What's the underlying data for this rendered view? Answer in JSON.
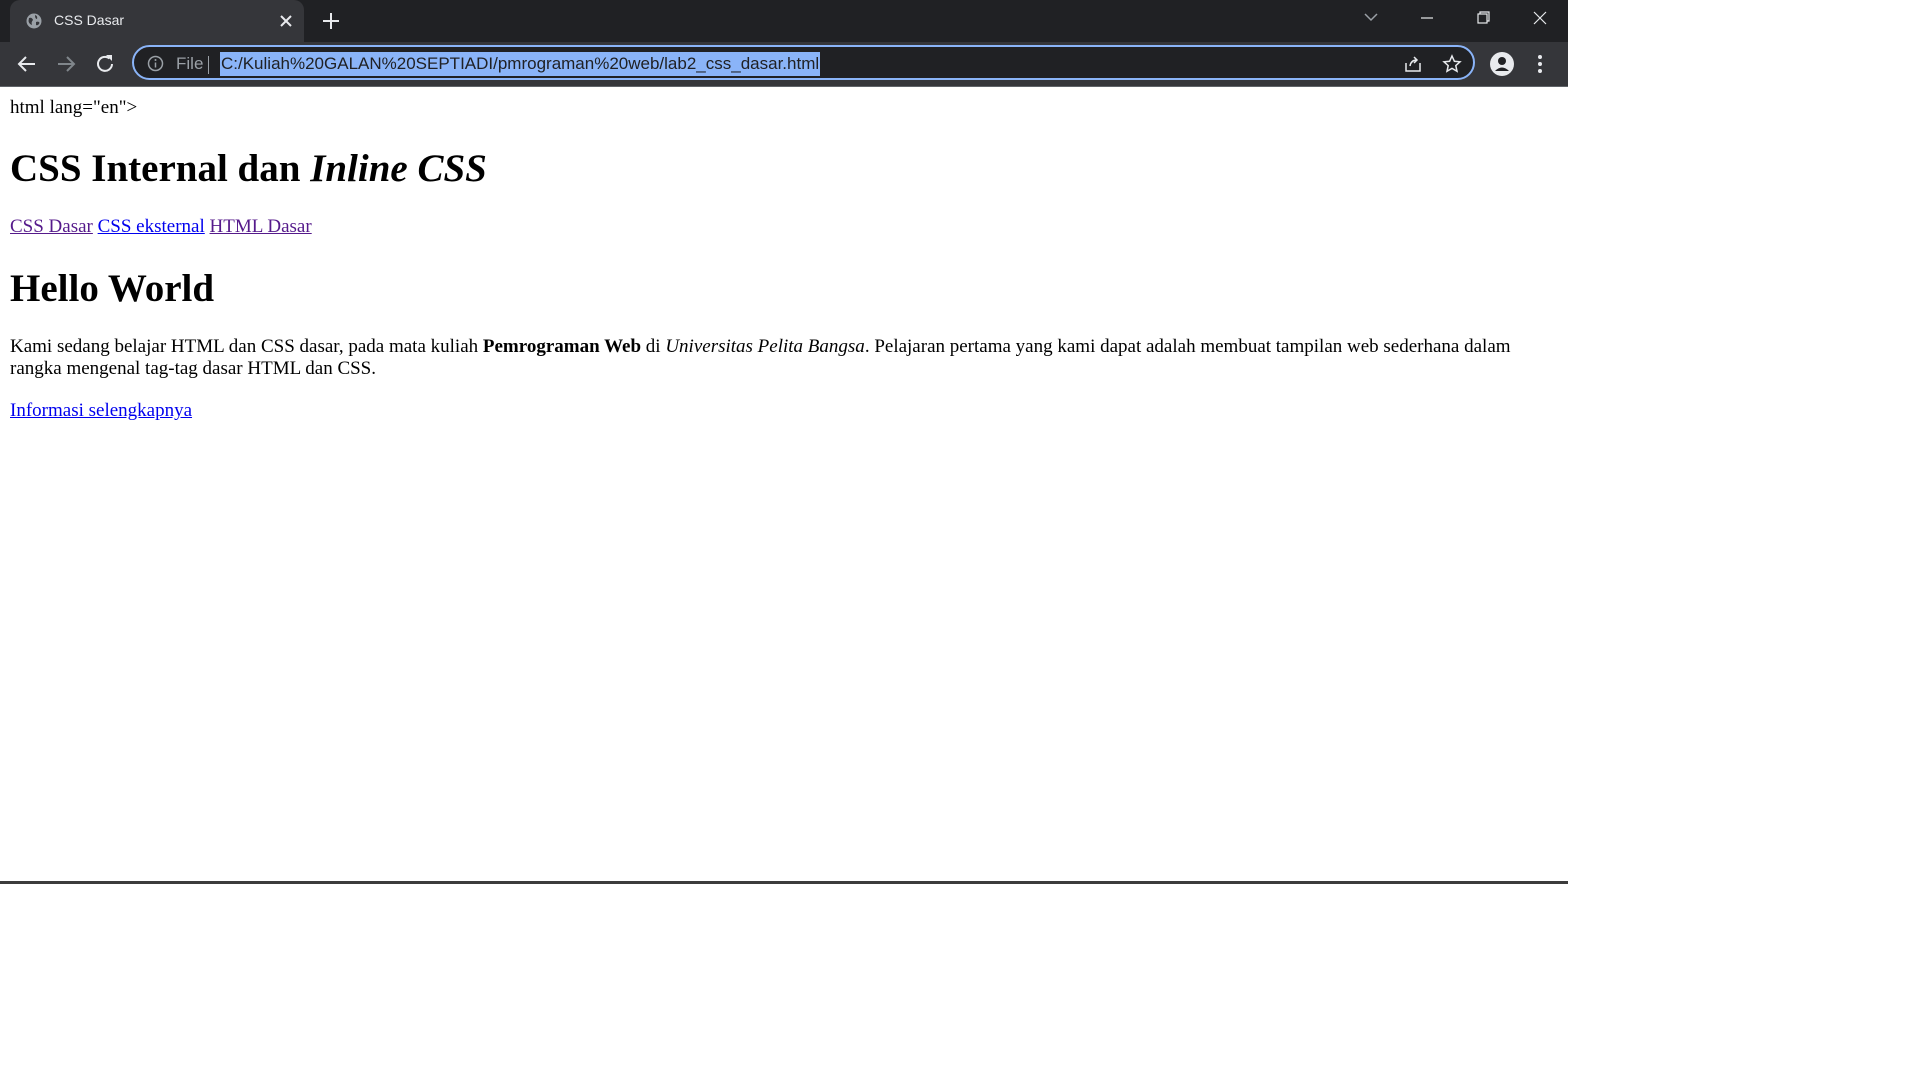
{
  "browser": {
    "tab_title": "CSS Dasar",
    "scheme_label": "File",
    "url": "C:/Kuliah%20GALAN%20SEPTIADI/pmrograman%20web/lab2_css_dasar.html"
  },
  "page": {
    "stray_text": "html lang=\"en\">",
    "heading1_plain": "CSS Internal dan ",
    "heading1_italic": "Inline CSS",
    "nav_links": [
      "CSS Dasar",
      "CSS eksternal",
      "HTML Dasar"
    ],
    "heading2": "Hello World",
    "paragraph": {
      "part1": "Kami sedang belajar HTML dan CSS dasar, pada mata kuliah ",
      "bold": "Pemrograman Web",
      "part2": " di ",
      "italic": "Universitas Pelita Bangsa",
      "part3": ". Pelajaran pertama yang kami dapat adalah membuat tampilan web sederhana dalam rangka mengenal tag-tag dasar HTML dan CSS."
    },
    "more_link": "Informasi selengkapnya"
  },
  "colors": {
    "chrome_bg": "#202124",
    "toolbar_bg": "#35363a",
    "url_highlight": "#8ab4f8",
    "link_unvisited": "#0000ee",
    "link_visited": "#551a8b"
  }
}
